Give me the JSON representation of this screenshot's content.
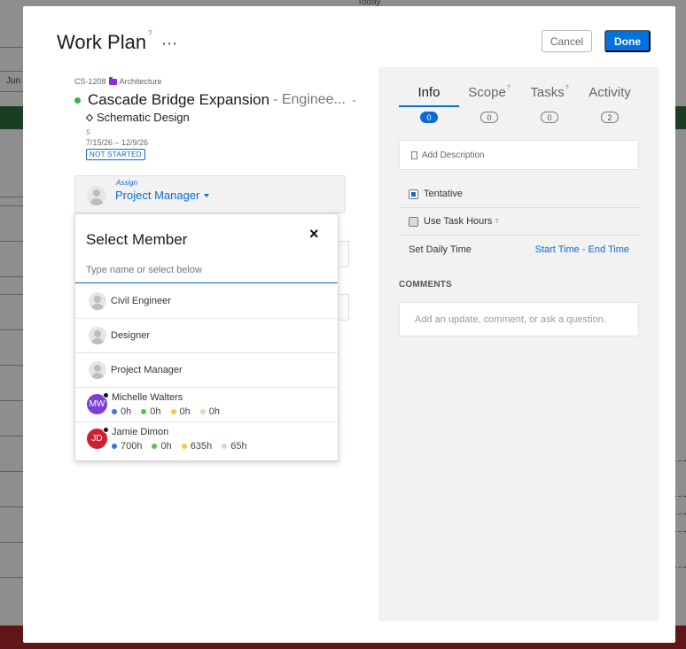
{
  "background": {
    "today_label": "Today",
    "month_label": "Jun"
  },
  "modal": {
    "title": "Work Plan",
    "help_mark": "?",
    "more_icon": "⋯",
    "cancel_label": "Cancel",
    "done_label": "Done"
  },
  "project": {
    "code": "CS-1208",
    "category": "Architecture",
    "name": "Cascade Bridge Expansion",
    "subtitle": "- Enginee...",
    "phase": "Schematic Design",
    "phase_number": "5",
    "dates": "7/15/26 – 12/9/26",
    "status": "NOT STARTED",
    "status_color": "#0b6ad4",
    "dot_color": "#3fae47"
  },
  "assign": {
    "label": "Assign",
    "value": "Project Manager"
  },
  "select_member": {
    "title": "Select Member",
    "close_icon": "×",
    "placeholder": "Type name or select below",
    "roles": [
      {
        "label": "Civil Engineer"
      },
      {
        "label": "Designer"
      },
      {
        "label": "Project Manager"
      }
    ],
    "people": [
      {
        "initials": "MW",
        "name": "Michelle Walters",
        "avatar_color": "#7b3fd6",
        "hours": [
          "0h",
          "0h",
          "0h",
          "0h"
        ]
      },
      {
        "initials": "JD",
        "name": "Jamie Dimon",
        "avatar_color": "#d0202f",
        "hours": [
          "700h",
          "0h",
          "635h",
          "65h"
        ]
      }
    ],
    "hour_colors": [
      "#2c7be5",
      "#5ac34c",
      "#f5c842",
      "#c4e8b8"
    ]
  },
  "tabs": [
    {
      "label": "Info",
      "count": "0",
      "help": ""
    },
    {
      "label": "Scope",
      "count": "0",
      "help": "?"
    },
    {
      "label": "Tasks",
      "count": "0",
      "help": "?"
    },
    {
      "label": "Activity",
      "count": "2",
      "help": ""
    }
  ],
  "info": {
    "add_description": "Add Description",
    "tentative_label": "Tentative",
    "use_task_hours_label": "Use Task Hours",
    "use_task_hours_help": "?",
    "set_daily_time_label": "Set Daily Time",
    "time_range": "Start Time - End Time",
    "comments_label": "COMMENTS",
    "comment_placeholder": "Add an update, comment, or ask a question."
  }
}
